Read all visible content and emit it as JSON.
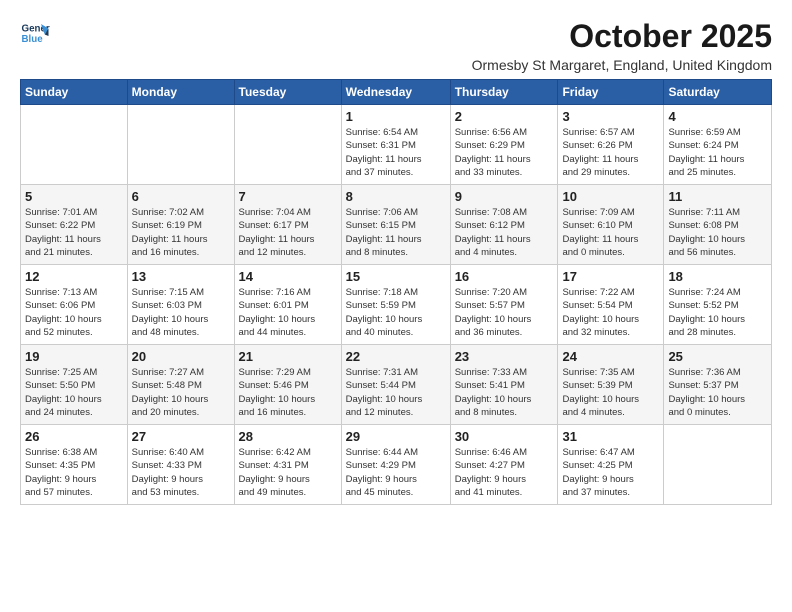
{
  "logo": {
    "line1": "General",
    "line2": "Blue"
  },
  "title": "October 2025",
  "location": "Ormesby St Margaret, England, United Kingdom",
  "days_of_week": [
    "Sunday",
    "Monday",
    "Tuesday",
    "Wednesday",
    "Thursday",
    "Friday",
    "Saturday"
  ],
  "weeks": [
    [
      {
        "day": "",
        "info": ""
      },
      {
        "day": "",
        "info": ""
      },
      {
        "day": "",
        "info": ""
      },
      {
        "day": "1",
        "info": "Sunrise: 6:54 AM\nSunset: 6:31 PM\nDaylight: 11 hours\nand 37 minutes."
      },
      {
        "day": "2",
        "info": "Sunrise: 6:56 AM\nSunset: 6:29 PM\nDaylight: 11 hours\nand 33 minutes."
      },
      {
        "day": "3",
        "info": "Sunrise: 6:57 AM\nSunset: 6:26 PM\nDaylight: 11 hours\nand 29 minutes."
      },
      {
        "day": "4",
        "info": "Sunrise: 6:59 AM\nSunset: 6:24 PM\nDaylight: 11 hours\nand 25 minutes."
      }
    ],
    [
      {
        "day": "5",
        "info": "Sunrise: 7:01 AM\nSunset: 6:22 PM\nDaylight: 11 hours\nand 21 minutes."
      },
      {
        "day": "6",
        "info": "Sunrise: 7:02 AM\nSunset: 6:19 PM\nDaylight: 11 hours\nand 16 minutes."
      },
      {
        "day": "7",
        "info": "Sunrise: 7:04 AM\nSunset: 6:17 PM\nDaylight: 11 hours\nand 12 minutes."
      },
      {
        "day": "8",
        "info": "Sunrise: 7:06 AM\nSunset: 6:15 PM\nDaylight: 11 hours\nand 8 minutes."
      },
      {
        "day": "9",
        "info": "Sunrise: 7:08 AM\nSunset: 6:12 PM\nDaylight: 11 hours\nand 4 minutes."
      },
      {
        "day": "10",
        "info": "Sunrise: 7:09 AM\nSunset: 6:10 PM\nDaylight: 11 hours\nand 0 minutes."
      },
      {
        "day": "11",
        "info": "Sunrise: 7:11 AM\nSunset: 6:08 PM\nDaylight: 10 hours\nand 56 minutes."
      }
    ],
    [
      {
        "day": "12",
        "info": "Sunrise: 7:13 AM\nSunset: 6:06 PM\nDaylight: 10 hours\nand 52 minutes."
      },
      {
        "day": "13",
        "info": "Sunrise: 7:15 AM\nSunset: 6:03 PM\nDaylight: 10 hours\nand 48 minutes."
      },
      {
        "day": "14",
        "info": "Sunrise: 7:16 AM\nSunset: 6:01 PM\nDaylight: 10 hours\nand 44 minutes."
      },
      {
        "day": "15",
        "info": "Sunrise: 7:18 AM\nSunset: 5:59 PM\nDaylight: 10 hours\nand 40 minutes."
      },
      {
        "day": "16",
        "info": "Sunrise: 7:20 AM\nSunset: 5:57 PM\nDaylight: 10 hours\nand 36 minutes."
      },
      {
        "day": "17",
        "info": "Sunrise: 7:22 AM\nSunset: 5:54 PM\nDaylight: 10 hours\nand 32 minutes."
      },
      {
        "day": "18",
        "info": "Sunrise: 7:24 AM\nSunset: 5:52 PM\nDaylight: 10 hours\nand 28 minutes."
      }
    ],
    [
      {
        "day": "19",
        "info": "Sunrise: 7:25 AM\nSunset: 5:50 PM\nDaylight: 10 hours\nand 24 minutes."
      },
      {
        "day": "20",
        "info": "Sunrise: 7:27 AM\nSunset: 5:48 PM\nDaylight: 10 hours\nand 20 minutes."
      },
      {
        "day": "21",
        "info": "Sunrise: 7:29 AM\nSunset: 5:46 PM\nDaylight: 10 hours\nand 16 minutes."
      },
      {
        "day": "22",
        "info": "Sunrise: 7:31 AM\nSunset: 5:44 PM\nDaylight: 10 hours\nand 12 minutes."
      },
      {
        "day": "23",
        "info": "Sunrise: 7:33 AM\nSunset: 5:41 PM\nDaylight: 10 hours\nand 8 minutes."
      },
      {
        "day": "24",
        "info": "Sunrise: 7:35 AM\nSunset: 5:39 PM\nDaylight: 10 hours\nand 4 minutes."
      },
      {
        "day": "25",
        "info": "Sunrise: 7:36 AM\nSunset: 5:37 PM\nDaylight: 10 hours\nand 0 minutes."
      }
    ],
    [
      {
        "day": "26",
        "info": "Sunrise: 6:38 AM\nSunset: 4:35 PM\nDaylight: 9 hours\nand 57 minutes."
      },
      {
        "day": "27",
        "info": "Sunrise: 6:40 AM\nSunset: 4:33 PM\nDaylight: 9 hours\nand 53 minutes."
      },
      {
        "day": "28",
        "info": "Sunrise: 6:42 AM\nSunset: 4:31 PM\nDaylight: 9 hours\nand 49 minutes."
      },
      {
        "day": "29",
        "info": "Sunrise: 6:44 AM\nSunset: 4:29 PM\nDaylight: 9 hours\nand 45 minutes."
      },
      {
        "day": "30",
        "info": "Sunrise: 6:46 AM\nSunset: 4:27 PM\nDaylight: 9 hours\nand 41 minutes."
      },
      {
        "day": "31",
        "info": "Sunrise: 6:47 AM\nSunset: 4:25 PM\nDaylight: 9 hours\nand 37 minutes."
      },
      {
        "day": "",
        "info": ""
      }
    ]
  ]
}
